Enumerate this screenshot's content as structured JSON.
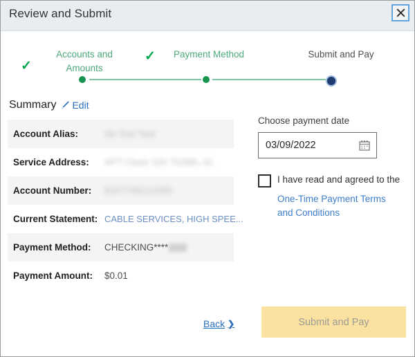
{
  "window": {
    "title": "Review and Submit",
    "close_label": "×",
    "close_icon": "close-icon"
  },
  "stepper": {
    "steps": [
      {
        "label": "Accounts and Amounts",
        "state": "complete",
        "check": "✓"
      },
      {
        "label": "Payment Method",
        "state": "complete",
        "check": "✓"
      },
      {
        "label": "Submit and Pay",
        "state": "current",
        "check": ""
      }
    ],
    "colors": {
      "complete_text": "#4ca97b",
      "complete_dot": "#17924f",
      "check": "#00a550",
      "current_text": "#4a4d50",
      "current_dot": "#1e3a73",
      "current_ring": "#9fb9dd",
      "track": "#7dc6a1"
    }
  },
  "summary": {
    "title": "Summary",
    "edit_label": "Edit",
    "edit_icon": "pencil-icon",
    "rows": [
      {
        "label": "Account Alias:",
        "value": "Ab Test Test",
        "redacted": true,
        "shaded": true
      },
      {
        "label": "Service Address:",
        "value": "APT Close 100 7028th, AL",
        "redacted": true,
        "shaded": false
      },
      {
        "label": "Account Number:",
        "value": "8247749212345",
        "redacted": true,
        "shaded": true
      },
      {
        "label": "Current Statement:",
        "value": "CABLE SERVICES, HIGH SPEE...",
        "redacted": false,
        "shaded": false
      },
      {
        "label": "Payment Method:",
        "value": "CHECKING****",
        "redacted": false,
        "shaded": true,
        "masked_tail": true
      },
      {
        "label": "Payment Amount:",
        "value": "$0.01",
        "redacted": false,
        "shaded": false
      }
    ]
  },
  "payment": {
    "date_label": "Choose payment date",
    "date_value": "03/09/2022",
    "date_placeholder": "mm/dd/yyyy",
    "calendar_icon": "calendar-icon",
    "agree_text": "I have read and agreed to the",
    "terms_link": "One-Time Payment Terms and Conditions",
    "checkbox_checked": false
  },
  "actions": {
    "back_label": "Back",
    "back_chevron": "❯",
    "submit_label": "Submit and Pay",
    "submit_disabled": true,
    "submit_bg": "#fce2a1",
    "submit_text_color": "#9c9a95"
  }
}
